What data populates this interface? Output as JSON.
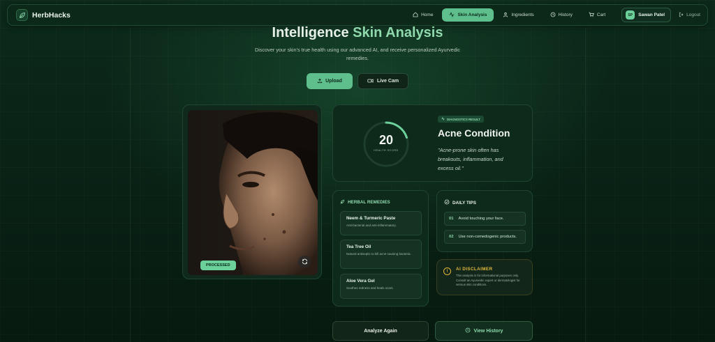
{
  "nav": {
    "brand": "HerbHacks",
    "items": [
      {
        "label": "Home",
        "icon": "home-icon"
      },
      {
        "label": "Skin Analysis",
        "icon": "activity-icon",
        "active": true
      },
      {
        "label": "Ingredients",
        "icon": "leaf-icon"
      },
      {
        "label": "History",
        "icon": "history-icon"
      },
      {
        "label": "Cart",
        "icon": "cart-icon"
      }
    ],
    "user": {
      "initials": "SP",
      "name": "Sawan Patel"
    },
    "logout": "Logout"
  },
  "header": {
    "title_main": "Intelligence",
    "title_accent": "Skin Analysis",
    "subtitle": "Discover your skin's true health using our advanced AI, and receive personalized Ayurvedic remedies."
  },
  "actions": {
    "upload": "Upload",
    "live_cam": "Live Cam"
  },
  "image_card": {
    "badge": "PROCESSED"
  },
  "result": {
    "score": "20",
    "score_fraction": 0.2,
    "score_label": "HEALTH SCORE",
    "badge": "DIAGNOSTICS RESULT",
    "condition": "Acne Condition",
    "quote": "\"Acne-prone skin often has breakouts, inflammation, and excess oil.\""
  },
  "remedies": {
    "title": "HERBAL REMEDIES",
    "items": [
      {
        "name": "Neem & Turmeric Paste",
        "desc": "Anti-bacterial and anti-inflammatory."
      },
      {
        "name": "Tea Tree Oil",
        "desc": "Natural antiseptic to kill acne-causing bacteria."
      },
      {
        "name": "Aloe Vera Gel",
        "desc": "Soothes redness and heals scars."
      }
    ]
  },
  "tips": {
    "title": "DAILY TIPS",
    "items": [
      {
        "num": "01",
        "text": "Avoid touching your face."
      },
      {
        "num": "02",
        "text": "Use non-comedogenic products."
      }
    ]
  },
  "disclaimer": {
    "title": "AI DISCLAIMER",
    "text": "This analysis is for informational purposes only. Consult an Ayurvedic expert or dermatologist for serious skin conditions."
  },
  "bottom": {
    "analyze_again": "Analyze Again",
    "view_history": "View History"
  },
  "colors": {
    "accent": "#5fbf8c",
    "accent_light": "#8fd9ac",
    "warning": "#e0b63a",
    "background": "#0a2317"
  }
}
